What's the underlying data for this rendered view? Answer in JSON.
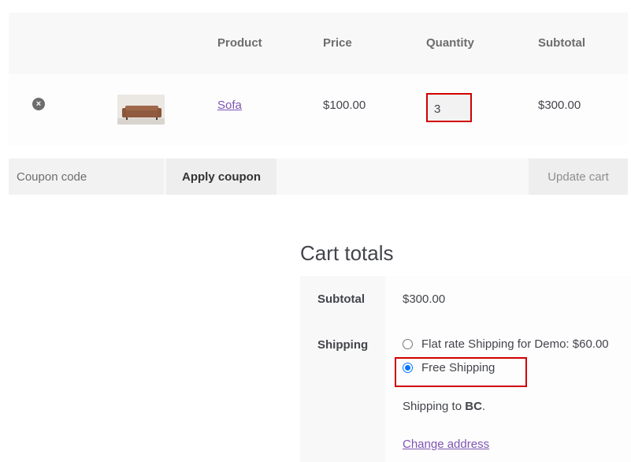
{
  "table": {
    "headers": {
      "product": "Product",
      "price": "Price",
      "quantity": "Quantity",
      "subtotal": "Subtotal"
    },
    "rows": [
      {
        "remove_icon": "remove-x-icon",
        "thumbnail": "sofa-thumbnail",
        "product": "Sofa",
        "price": "$100.00",
        "quantity": "3",
        "subtotal": "$300.00"
      }
    ]
  },
  "actions": {
    "coupon_placeholder": "Coupon code",
    "apply_label": "Apply coupon",
    "update_label": "Update cart"
  },
  "totals": {
    "title": "Cart totals",
    "subtotal_label": "Subtotal",
    "subtotal_value": "$300.00",
    "shipping_label": "Shipping",
    "shipping_options": [
      {
        "label": "Flat rate Shipping for Demo: $60.00",
        "checked": false
      },
      {
        "label": "Free Shipping",
        "checked": true
      }
    ],
    "shipping_to_prefix": "Shipping to ",
    "shipping_to_region": "BC",
    "shipping_to_suffix": ".",
    "change_address": "Change address"
  },
  "colors": {
    "link": "#7f54b3",
    "highlight": "#d00000",
    "radio_accent": "#0075ff"
  }
}
